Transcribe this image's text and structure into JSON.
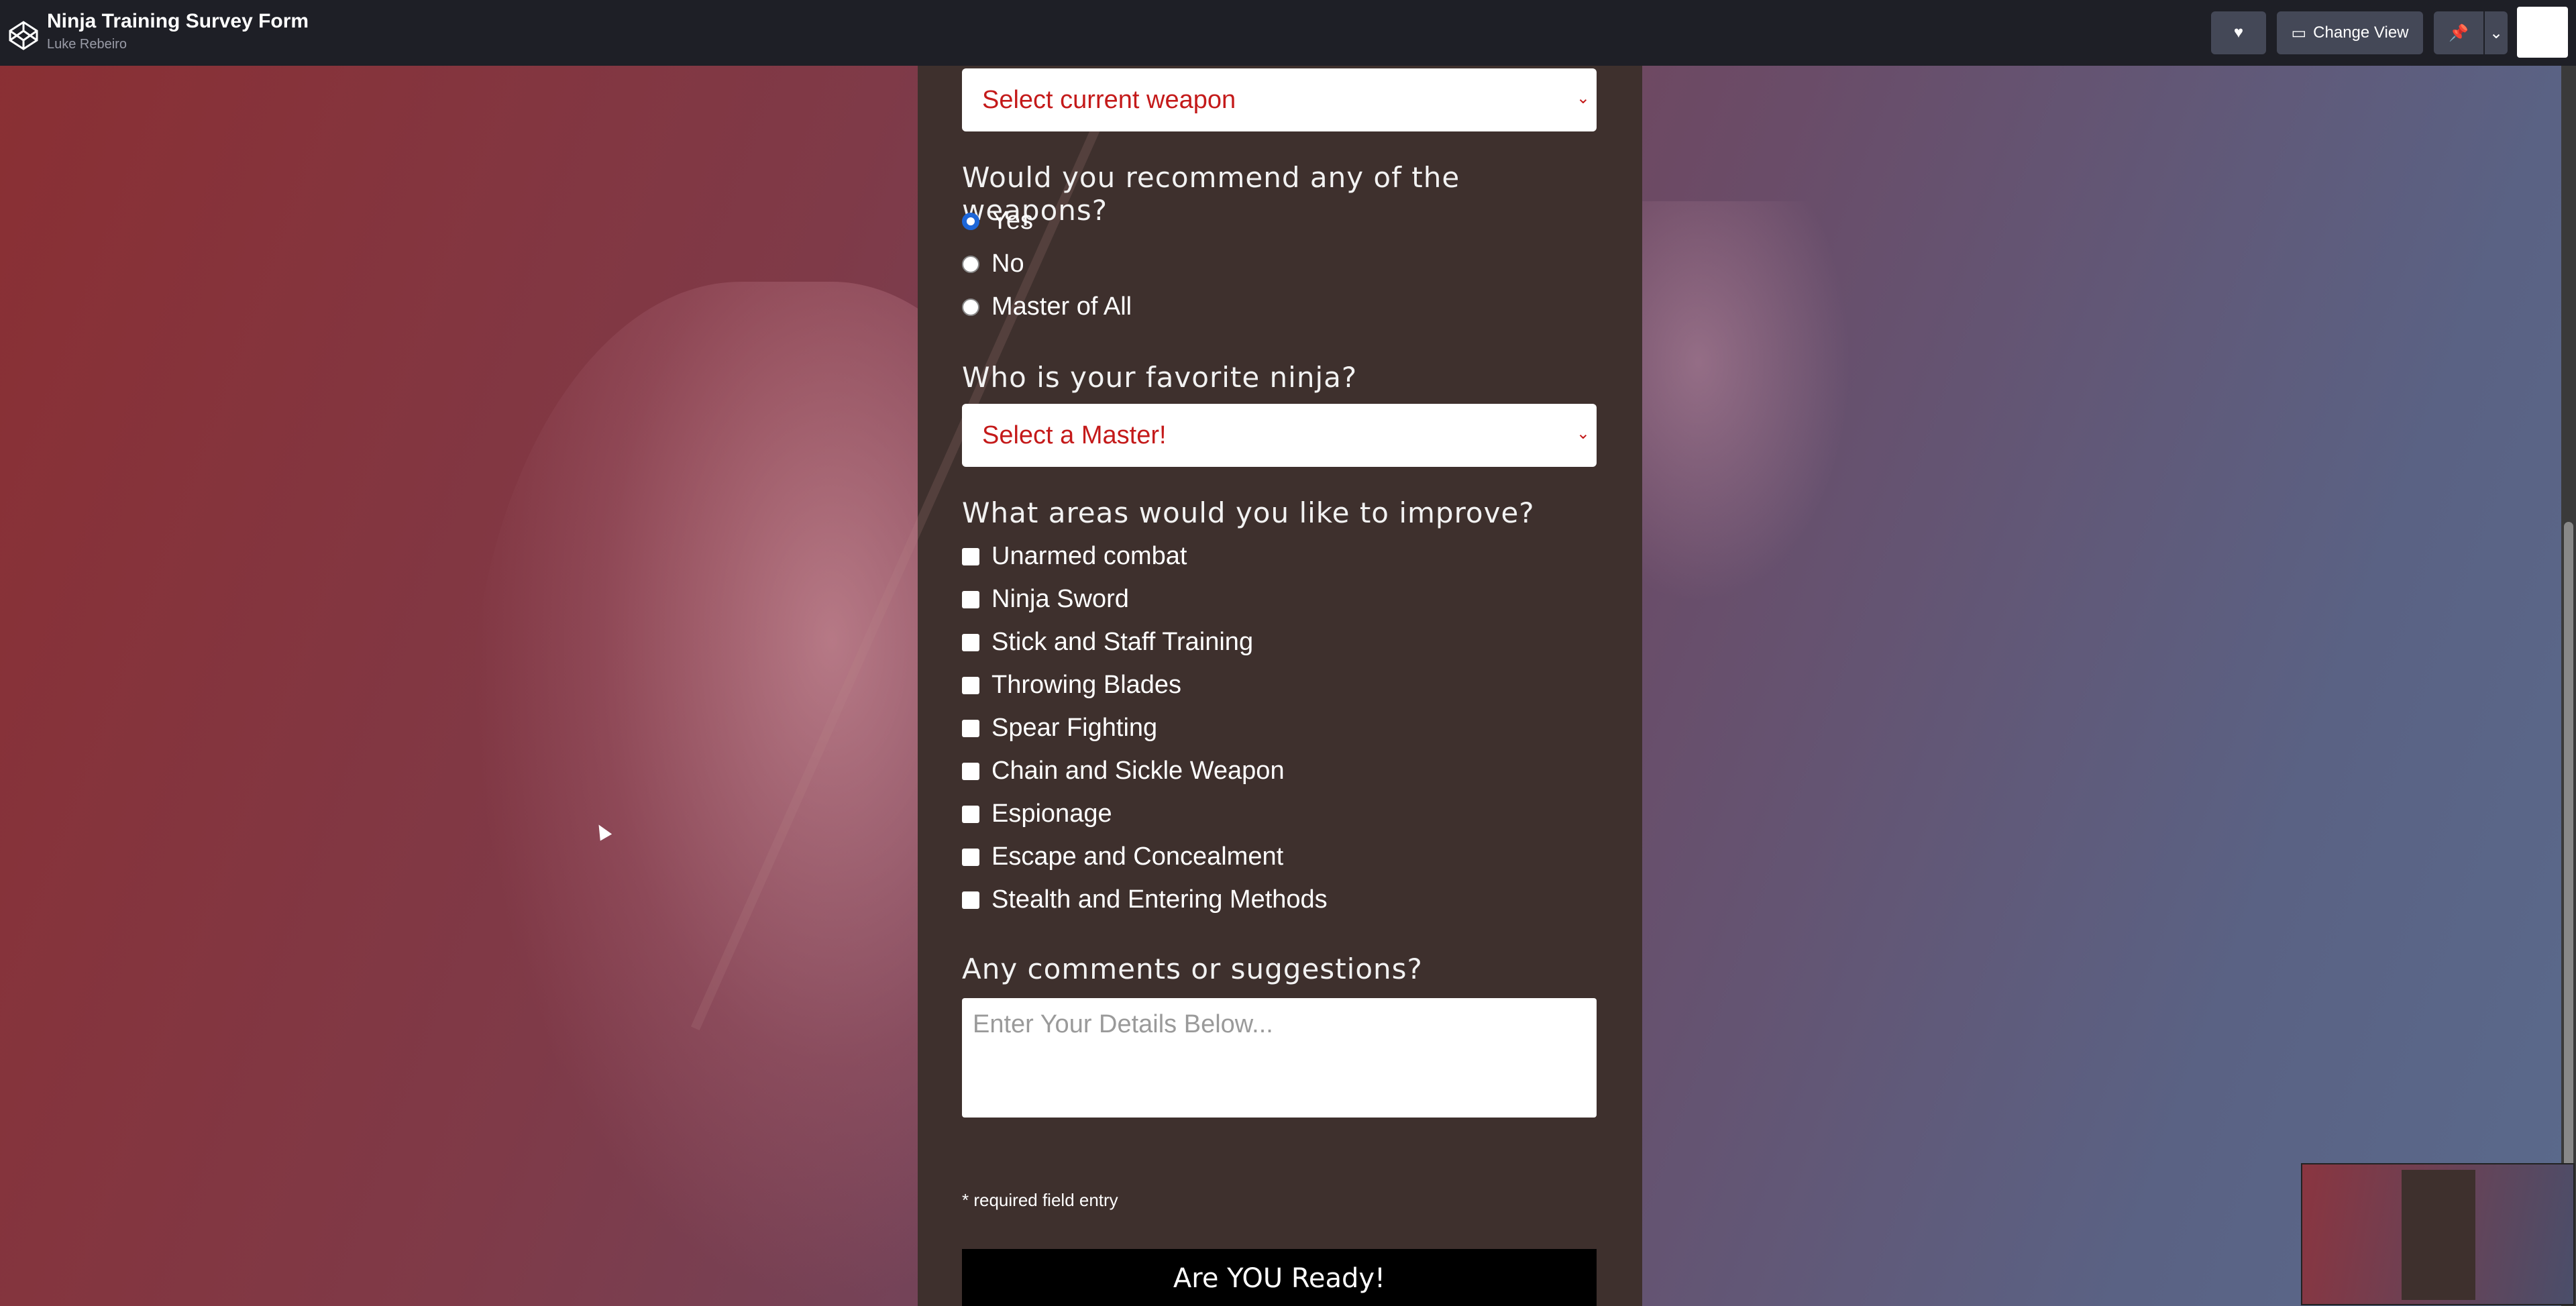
{
  "header": {
    "title": "Ninja Training Survey Form",
    "author": "Luke Rebeiro",
    "change_view_label": "Change View"
  },
  "form": {
    "weapon_select": {
      "value": "Select current weapon"
    },
    "recommend": {
      "question": "Would you recommend any of the weapons?",
      "options": [
        "Yes",
        "No",
        "Master of All"
      ],
      "selected": "Yes"
    },
    "favorite": {
      "question": "Who is your favorite ninja?",
      "select_value": "Select a Master!"
    },
    "improve": {
      "question": "What areas would you like to improve?",
      "options": [
        "Unarmed combat",
        "Ninja Sword",
        "Stick and Staff Training",
        "Throwing Blades",
        "Spear Fighting",
        "Chain and Sickle Weapon",
        "Espionage",
        "Escape and Concealment",
        "Stealth and Entering Methods"
      ]
    },
    "comments": {
      "question": "Any comments or suggestions?",
      "placeholder": "Enter Your Details Below..."
    },
    "required_note": "* required field entry",
    "submit_label": "Are YOU Ready!"
  },
  "colors": {
    "select_text": "#c41a1a",
    "panel": "#3e302d",
    "radio_accent": "#1d66d8"
  }
}
